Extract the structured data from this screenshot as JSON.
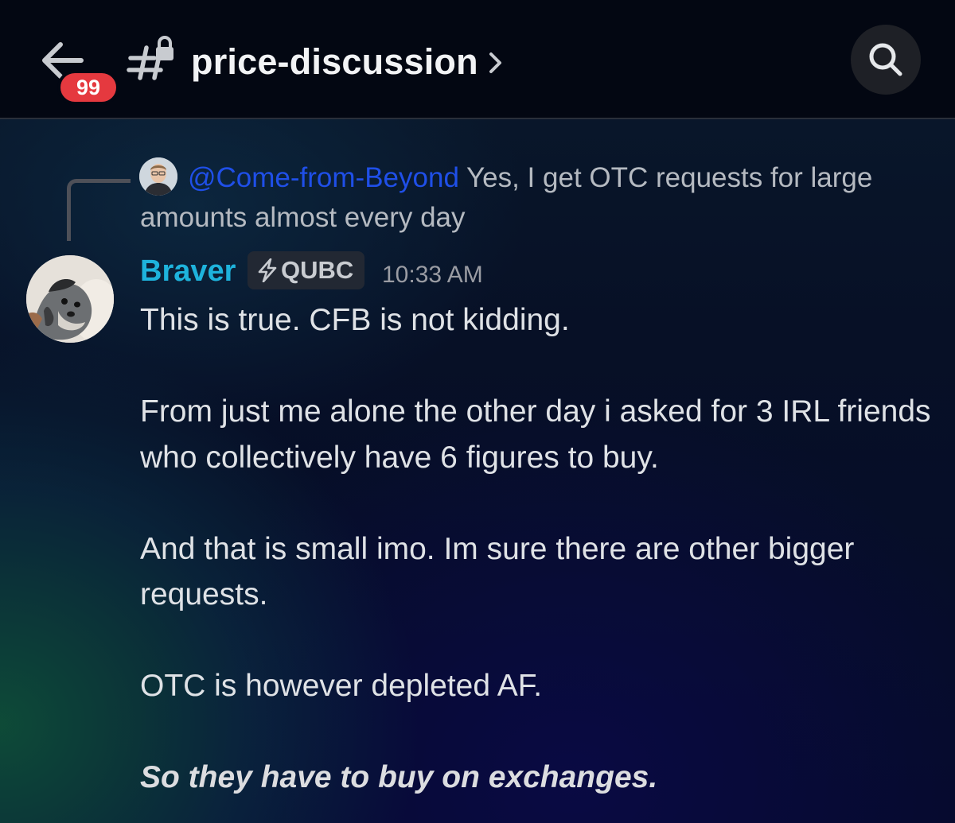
{
  "header": {
    "unread_count": "99",
    "channel_name": "price-discussion",
    "icons": {
      "back": "arrow-left-icon",
      "channel": "locked-hash-icon",
      "more": "chevron-right-icon",
      "search": "search-icon"
    }
  },
  "reply": {
    "mention": "@Come-from-Beyond",
    "text_line1": "Yes, I get OTC requests for large",
    "text_line2": "amounts almost every day",
    "avatar": "user-avatar"
  },
  "message": {
    "username": "Braver",
    "role_icon": "lightning-icon",
    "role_tag": "QUBC",
    "timestamp": "10:33 AM",
    "paragraphs": [
      "This is true. CFB is not kidding.",
      "From just me alone the other day i asked for 3 IRL friends who collectively have 6 figures to buy.",
      "And that is small imo. Im sure there are other bigger requests.",
      "OTC is however depleted AF.",
      "So they have to buy on exchanges."
    ]
  },
  "colors": {
    "header_bg": "#030712",
    "badge": "#e5393f",
    "username": "#1eb3dc",
    "mention": "#1f4fe8",
    "text": "#dfe2e6",
    "muted": "#b5bac1"
  }
}
